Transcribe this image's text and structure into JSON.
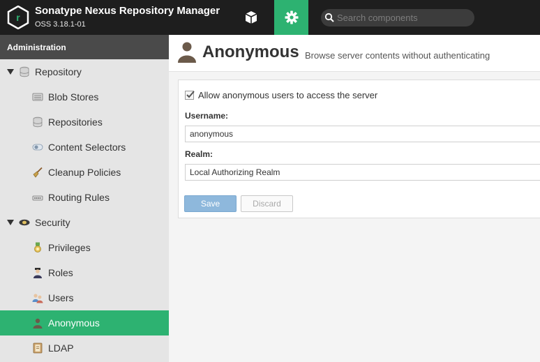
{
  "header": {
    "title": "Sonatype Nexus Repository Manager",
    "version": "OSS 3.18.1-01",
    "nav": [
      {
        "name": "browse",
        "icon": "cube-icon"
      },
      {
        "name": "administration",
        "icon": "gear-icon",
        "active": true
      }
    ],
    "search": {
      "placeholder": "Search components",
      "value": ""
    }
  },
  "sidebar": {
    "heading": "Administration",
    "items": [
      {
        "label": "Repository",
        "icon": "database-icon",
        "expanded": true
      },
      {
        "label": "Blob Stores",
        "icon": "server-icon"
      },
      {
        "label": "Repositories",
        "icon": "database-icon"
      },
      {
        "label": "Content Selectors",
        "icon": "selector-icon"
      },
      {
        "label": "Cleanup Policies",
        "icon": "broom-icon"
      },
      {
        "label": "Routing Rules",
        "icon": "router-icon"
      },
      {
        "label": "Security",
        "icon": "police-badge-icon",
        "expanded": true
      },
      {
        "label": "Privileges",
        "icon": "medal-icon"
      },
      {
        "label": "Roles",
        "icon": "officer-icon"
      },
      {
        "label": "Users",
        "icon": "users-icon"
      },
      {
        "label": "Anonymous",
        "icon": "user-silhouette-icon",
        "selected": true
      },
      {
        "label": "LDAP",
        "icon": "address-book-icon"
      }
    ]
  },
  "main": {
    "title": "Anonymous",
    "subtitle": "Browse server contents without authenticating",
    "form": {
      "allow_label": "Allow anonymous users to access the server",
      "allow_checked": true,
      "username_label": "Username:",
      "username_value": "anonymous",
      "realm_label": "Realm:",
      "realm_value": "Local Authorizing Realm",
      "save_label": "Save",
      "discard_label": "Discard"
    }
  },
  "colors": {
    "accent": "#2db271",
    "header_bg": "#1e1e1e",
    "sidebar_head_bg": "#4a4a4a",
    "save_button": "#8eb8dc"
  }
}
